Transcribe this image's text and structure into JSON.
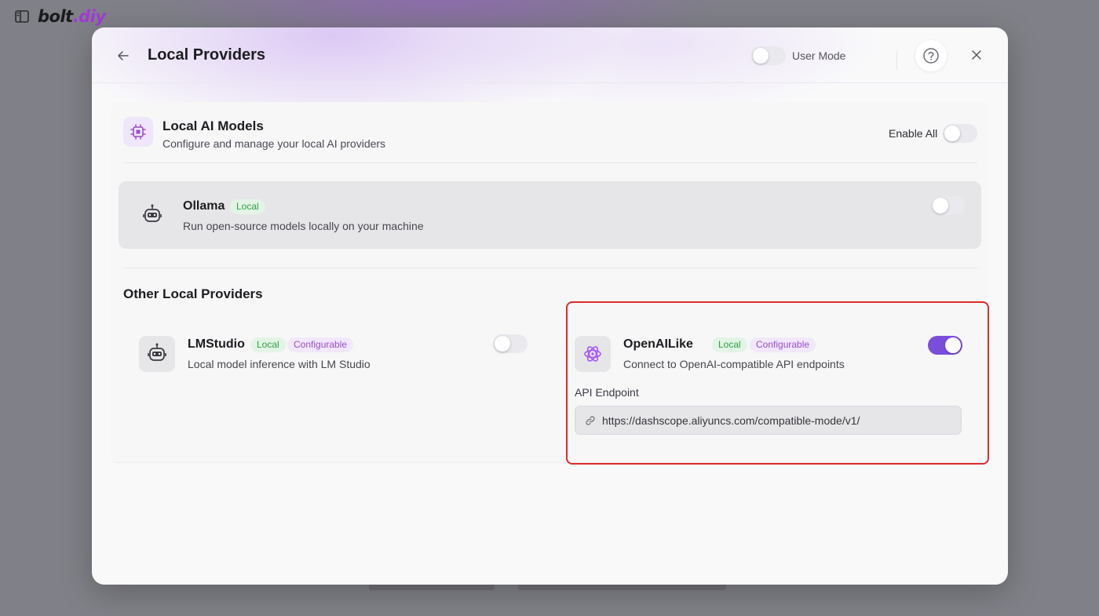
{
  "app": {
    "logo_main": "bolt",
    "logo_accent": ".diy"
  },
  "header": {
    "title": "Local Providers",
    "mode_label": "User Mode",
    "mode_enabled": false
  },
  "section": {
    "title": "Local AI Models",
    "subtitle": "Configure and manage your local AI providers",
    "enable_all_label": "Enable All",
    "enable_all": false
  },
  "ollama": {
    "name": "Ollama",
    "badge_local": "Local",
    "description": "Run open-source models locally on your machine",
    "enabled": false
  },
  "other": {
    "title": "Other Local Providers",
    "providers": [
      {
        "name": "LMStudio",
        "badge_local": "Local",
        "badge_config": "Configurable",
        "description": "Local model inference with LM Studio",
        "enabled": false
      },
      {
        "name": "OpenAILike",
        "badge_local": "Local",
        "badge_config": "Configurable",
        "description": "Connect to OpenAI-compatible API endpoints",
        "enabled": true,
        "endpoint_label": "API Endpoint",
        "endpoint_value": "https://dashscope.aliyuncs.com/compatible-mode/v1/"
      }
    ]
  },
  "colors": {
    "accent": "#7c4ddb",
    "badge_local_bg": "#e3f4e6",
    "badge_local_text": "#2ea043",
    "badge_config_bg": "#f1e8fb",
    "badge_config_text": "#9b4dca",
    "highlight": "#e02b2b"
  },
  "icons": {
    "sidebar": "sidebar-toggle-icon",
    "back": "arrow-left-icon",
    "help": "question-circle-icon",
    "close": "close-icon",
    "section": "cpu-chip-icon",
    "ollama": "robot-icon",
    "lmstudio": "robot-icon",
    "openai": "openai-logo-icon",
    "endpoint": "link-icon"
  }
}
